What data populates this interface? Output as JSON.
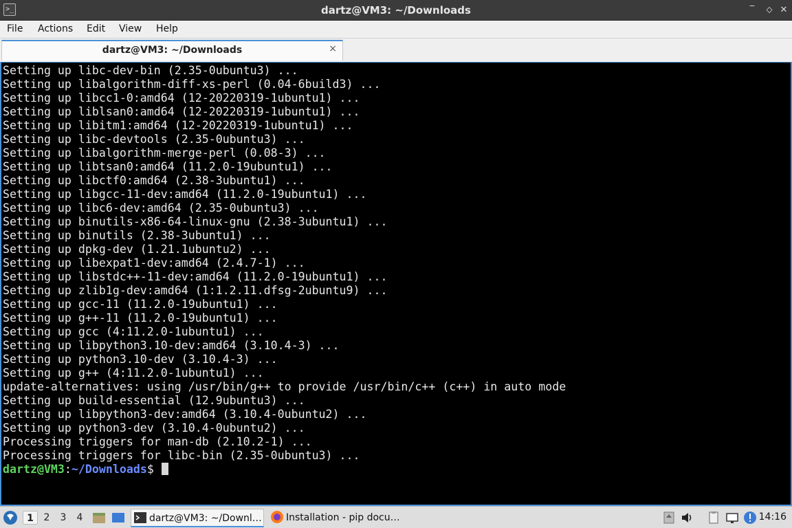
{
  "window": {
    "title": "dartz@VM3: ~/Downloads",
    "controls": {
      "minimize": "‾",
      "maximize": "⌃",
      "restore": "⬦",
      "close": "✕"
    }
  },
  "menu": [
    "File",
    "Actions",
    "Edit",
    "View",
    "Help"
  ],
  "tab": {
    "label": "dartz@VM3: ~/Downloads",
    "close": "×"
  },
  "terminal": {
    "lines": [
      "Setting up libc-dev-bin (2.35-0ubuntu3) ...",
      "Setting up libalgorithm-diff-xs-perl (0.04-6build3) ...",
      "Setting up libcc1-0:amd64 (12-20220319-1ubuntu1) ...",
      "Setting up liblsan0:amd64 (12-20220319-1ubuntu1) ...",
      "Setting up libitm1:amd64 (12-20220319-1ubuntu1) ...",
      "Setting up libc-devtools (2.35-0ubuntu3) ...",
      "Setting up libalgorithm-merge-perl (0.08-3) ...",
      "Setting up libtsan0:amd64 (11.2.0-19ubuntu1) ...",
      "Setting up libctf0:amd64 (2.38-3ubuntu1) ...",
      "Setting up libgcc-11-dev:amd64 (11.2.0-19ubuntu1) ...",
      "Setting up libc6-dev:amd64 (2.35-0ubuntu3) ...",
      "Setting up binutils-x86-64-linux-gnu (2.38-3ubuntu1) ...",
      "Setting up binutils (2.38-3ubuntu1) ...",
      "Setting up dpkg-dev (1.21.1ubuntu2) ...",
      "Setting up libexpat1-dev:amd64 (2.4.7-1) ...",
      "Setting up libstdc++-11-dev:amd64 (11.2.0-19ubuntu1) ...",
      "Setting up zlib1g-dev:amd64 (1:1.2.11.dfsg-2ubuntu9) ...",
      "Setting up gcc-11 (11.2.0-19ubuntu1) ...",
      "Setting up g++-11 (11.2.0-19ubuntu1) ...",
      "Setting up gcc (4:11.2.0-1ubuntu1) ...",
      "Setting up libpython3.10-dev:amd64 (3.10.4-3) ...",
      "Setting up python3.10-dev (3.10.4-3) ...",
      "Setting up g++ (4:11.2.0-1ubuntu1) ...",
      "update-alternatives: using /usr/bin/g++ to provide /usr/bin/c++ (c++) in auto mode",
      "Setting up build-essential (12.9ubuntu3) ...",
      "Setting up libpython3-dev:amd64 (3.10.4-0ubuntu2) ...",
      "Setting up python3-dev (3.10.4-0ubuntu2) ...",
      "Processing triggers for man-db (2.10.2-1) ...",
      "Processing triggers for libc-bin (2.35-0ubuntu3) ..."
    ],
    "prompt": {
      "user_host": "dartz@VM3",
      "separator": ":",
      "path": "~/Downloads",
      "symbol": "$ "
    }
  },
  "taskbar": {
    "workspaces": [
      "1",
      "2",
      "3",
      "4"
    ],
    "tasks": [
      {
        "label": "dartz@VM3: ~/Downl…",
        "icon": "terminal-icon"
      },
      {
        "label": "Installation - pip docu…",
        "icon": "firefox-icon"
      }
    ],
    "clock": "14:16",
    "colors": {
      "accent": "#4a90d9",
      "prompt_user": "#5fd35f",
      "prompt_path": "#6b8cff"
    }
  }
}
